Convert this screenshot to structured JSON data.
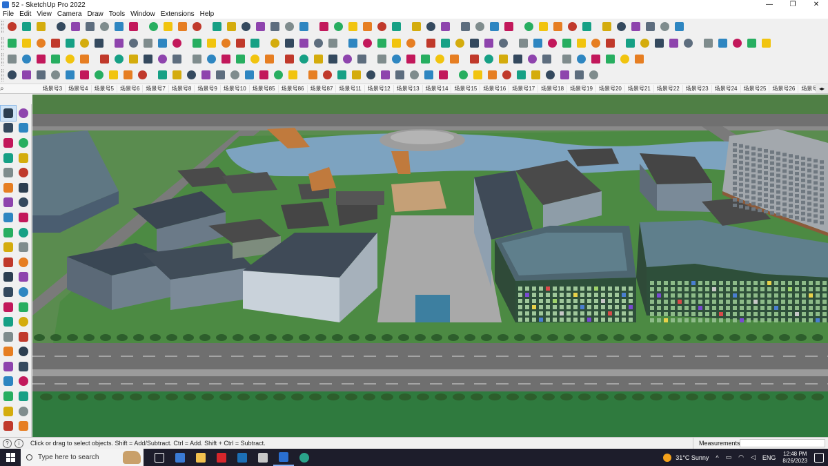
{
  "window": {
    "title": "52 - SketchUp Pro 2022",
    "minimize": "—",
    "maximize": "❐",
    "close": "✕"
  },
  "menu": [
    "File",
    "Edit",
    "View",
    "Camera",
    "Draw",
    "Tools",
    "Window",
    "Extensions",
    "Help"
  ],
  "scenes": {
    "search_icon": "⌕",
    "tabs": [
      "场景号3",
      "场景号4",
      "场景号5",
      "场景号6",
      "场景号7",
      "场景号8",
      "场景号9",
      "场景号10",
      "场景号85",
      "场景号86",
      "场景号87",
      "场景号11",
      "场景号12",
      "场景号13",
      "场景号14",
      "场景号15",
      "场景号16",
      "场景号17",
      "场景号18",
      "场景号19",
      "场景号20",
      "场景号21",
      "场景号22",
      "场景号23",
      "场景号24",
      "场景号25",
      "场景号26",
      "场景号27",
      "场景号28",
      "场景号29"
    ],
    "scroll": "◂▸"
  },
  "status": {
    "icon_geo": "?",
    "icon_info": "i",
    "message": "Click or drag to select objects. Shift = Add/Subtract. Ctrl = Add. Shift + Ctrl = Subtract.",
    "measurements_label": "Measurements"
  },
  "taskbar": {
    "search_placeholder": "Type here to search",
    "weather": "31°C  Sunny",
    "tray_chevron": "^",
    "language": "ENG",
    "time": "12:48 PM",
    "date": "8/26/2023"
  },
  "colors": {
    "toolbar_bg": "#f0f0f0",
    "taskbar_bg": "#1d1d2b",
    "ground_green": "#5a8c4f",
    "road_gray": "#6f6f6f",
    "water_blue": "#7da3c0",
    "glass_dark": "#2f3a46"
  }
}
